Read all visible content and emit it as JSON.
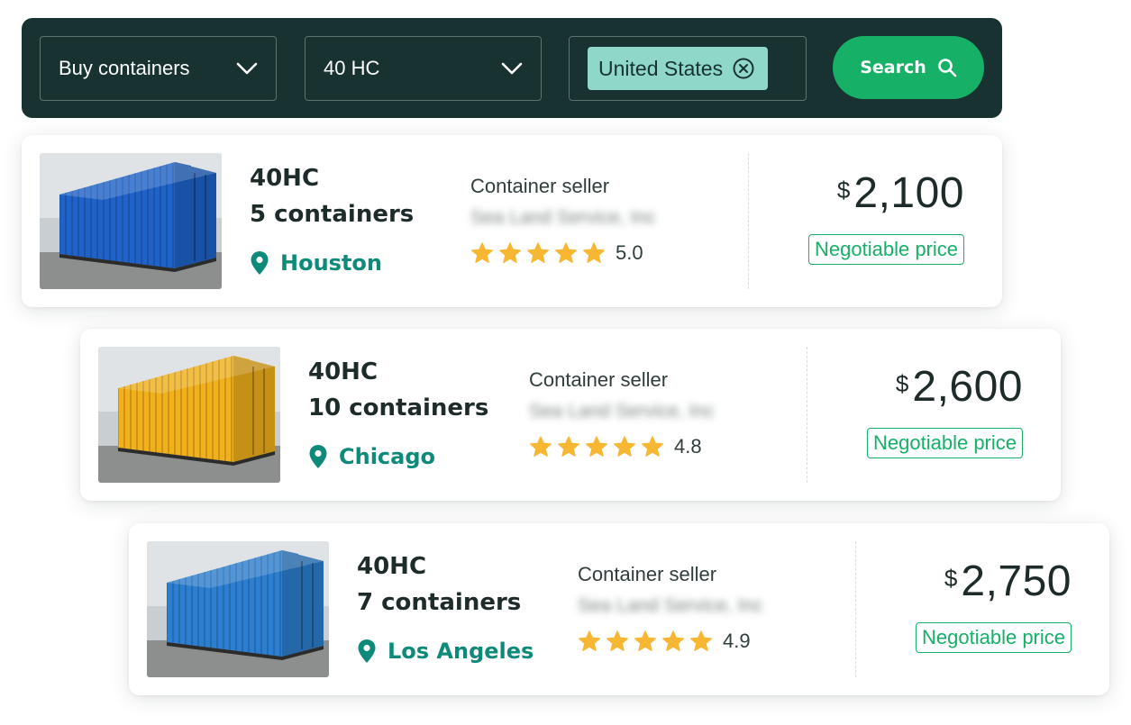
{
  "search": {
    "type_select": "Buy containers",
    "size_select": "40 HC",
    "country_chip": "United States",
    "search_label": "Search"
  },
  "colors": {
    "bar_bg": "#173231",
    "accent_green": "#16b066",
    "chip_bg": "#8fd8c8",
    "location_teal": "#0d8a7a",
    "star": "#f7b733"
  },
  "icons": {
    "dropdown": "chevron-down-icon",
    "chip_remove": "close-circle-icon",
    "search": "search-icon",
    "location": "map-pin-icon",
    "star": "star-icon"
  },
  "listings": [
    {
      "type": "40HC",
      "quantity": "5 containers",
      "location": "Houston",
      "seller_label": "Container seller",
      "seller_name": "Sea Land Service, Inc",
      "rating": "5.0",
      "currency": "$",
      "price": "2,100",
      "price_note": "Negotiable price",
      "container_color": "#1f63c9"
    },
    {
      "type": "40HC",
      "quantity": "10 containers",
      "location": "Chicago",
      "seller_label": "Container seller",
      "seller_name": "Sea Land Service, Inc",
      "rating": "4.8",
      "currency": "$",
      "price": "2,600",
      "price_note": "Negotiable price",
      "container_color": "#f1b01c"
    },
    {
      "type": "40HC",
      "quantity": "7 containers",
      "location": "Los Angeles",
      "seller_label": "Container seller",
      "seller_name": "Sea Land Service, Inc",
      "rating": "4.9",
      "currency": "$",
      "price": "2,750",
      "price_note": "Negotiable price",
      "container_color": "#2c7fd0"
    }
  ]
}
